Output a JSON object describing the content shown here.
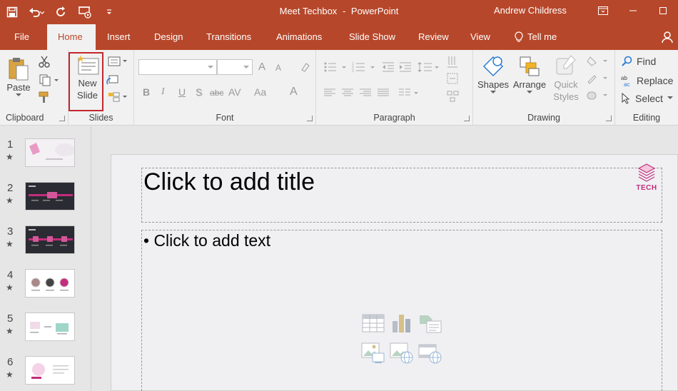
{
  "window": {
    "doc_name": "Meet Techbox",
    "separator": "-",
    "app_name": "PowerPoint",
    "user": "Andrew Childress"
  },
  "tabs": [
    {
      "label": "File"
    },
    {
      "label": "Home"
    },
    {
      "label": "Insert"
    },
    {
      "label": "Design"
    },
    {
      "label": "Transitions"
    },
    {
      "label": "Animations"
    },
    {
      "label": "Slide Show"
    },
    {
      "label": "Review"
    },
    {
      "label": "View"
    },
    {
      "label": "Tell me"
    }
  ],
  "ribbon": {
    "clipboard": {
      "label": "Clipboard",
      "paste": "Paste"
    },
    "slides": {
      "label": "Slides",
      "new_slide_line1": "New",
      "new_slide_line2": "Slide"
    },
    "font": {
      "label": "Font",
      "bold": "B",
      "italic": "I",
      "underline": "U",
      "shadow": "S",
      "strike": "abc",
      "spacing": "AV",
      "case": "Aa",
      "color": "A",
      "grow": "A",
      "shrink": "A"
    },
    "paragraph": {
      "label": "Paragraph"
    },
    "drawing": {
      "label": "Drawing",
      "shapes": "Shapes",
      "arrange": "Arrange",
      "quick_styles_line1": "Quick",
      "quick_styles_line2": "Styles"
    },
    "editing": {
      "label": "Editing",
      "find": "Find",
      "replace": "Replace",
      "select": "Select"
    }
  },
  "slides": [
    {
      "num": "1",
      "star": "★"
    },
    {
      "num": "2",
      "star": "★"
    },
    {
      "num": "3",
      "star": "★"
    },
    {
      "num": "4",
      "star": "★"
    },
    {
      "num": "5",
      "star": "★"
    },
    {
      "num": "6",
      "star": "★"
    }
  ],
  "slide": {
    "title_placeholder": "Click to add title",
    "body_placeholder": "• Click to add text",
    "logo_text": "TECH"
  },
  "colors": {
    "accent": "#b7472a",
    "highlight": "#c4262e",
    "logo": "#c22d7c"
  }
}
